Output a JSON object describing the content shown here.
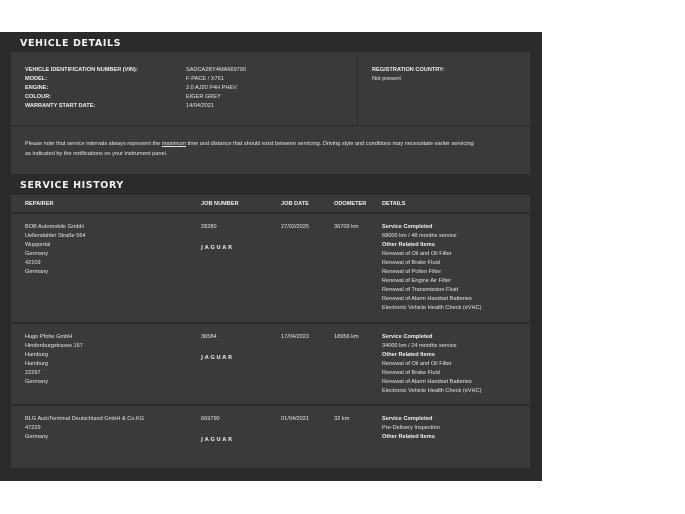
{
  "vehicle": {
    "title": "VEHICLE DETAILS",
    "fields": [
      {
        "label": "VEHICLE IDENTIFICATION NUMBER (VIN):",
        "value": "SADCA2BY4MA669790"
      },
      {
        "label": "MODEL:",
        "value": "F-PACE / X761"
      },
      {
        "label": "ENGINE:",
        "value": "2.0 AJ20 P4H PHEV"
      },
      {
        "label": "COLOUR:",
        "value": "EIGER GREY"
      },
      {
        "label": "WARRANTY START DATE:",
        "value": "14/04/2021"
      }
    ],
    "registration_country_label": "REGISTRATION COUNTRY:",
    "registration_country_value": "Not present",
    "note_before": "Please note that service intervals always represent the ",
    "note_link": "maximum",
    "note_after": " time and distance that should exist between servicing. Driving style and conditions may necessitate earlier servicing",
    "note_line2": "as indicated by the notifications on your instrument panel."
  },
  "service_history": {
    "title": "SERVICE HISTORY",
    "columns": {
      "repairer": "REPAIRER",
      "job_number": "JOB NUMBER",
      "job_date": "JOB DATE",
      "odometer": "ODOMETER",
      "details": "DETAILS"
    },
    "logo_text": "JAGUAR",
    "rows": [
      {
        "repairer": [
          "BOB Automobile GmbH",
          "Uellendahler Straße 564",
          "Wuppertal",
          "Germany",
          "42109",
          "Germany"
        ],
        "job_number": "28280",
        "job_date": "27/02/2025",
        "odometer": "36709 km",
        "details_title": "Service Completed",
        "details_sub": "68000 km / 48 months service",
        "other_title": "Other Related Items",
        "items": [
          "Renewal of Oil and Oil Filter",
          "Renewal of Brake Fluid",
          "Renewal of Pollen Filter",
          "Renewal of Engine Air Filter",
          "Renewal of Transmission Fluid",
          "Renewal of Alarm Handset Batteries",
          "Electronic Vehicle Health Check (eVHC)"
        ]
      },
      {
        "repairer": [
          "Hugo Pfohe GmbH",
          "Hindenburgstrasse 167",
          "Hamburg",
          "Hamburg",
          "22297",
          "Germany"
        ],
        "job_number": "36584",
        "job_date": "17/04/2023",
        "odometer": "18956 km",
        "details_title": "Service Completed",
        "details_sub": "34000 km / 24 months service",
        "other_title": "Other Related Items",
        "items": [
          "Renewal of Oil and Oil Filter",
          "Renewal of Brake Fluid",
          "Renewal of Alarm Handset Batteries",
          "Electronic Vehicle Health Check (eVHC)"
        ]
      },
      {
        "repairer": [
          "BLG AutoTerminal Deutschland GmbH & Co.KG",
          "47229",
          "Germany"
        ],
        "job_number": "669790",
        "job_date": "01/04/2021",
        "odometer": "32 km",
        "details_title": "Service Completed",
        "details_sub": "Pre-Delivery Inspection",
        "other_title": "Other Related Items",
        "items": []
      }
    ]
  }
}
